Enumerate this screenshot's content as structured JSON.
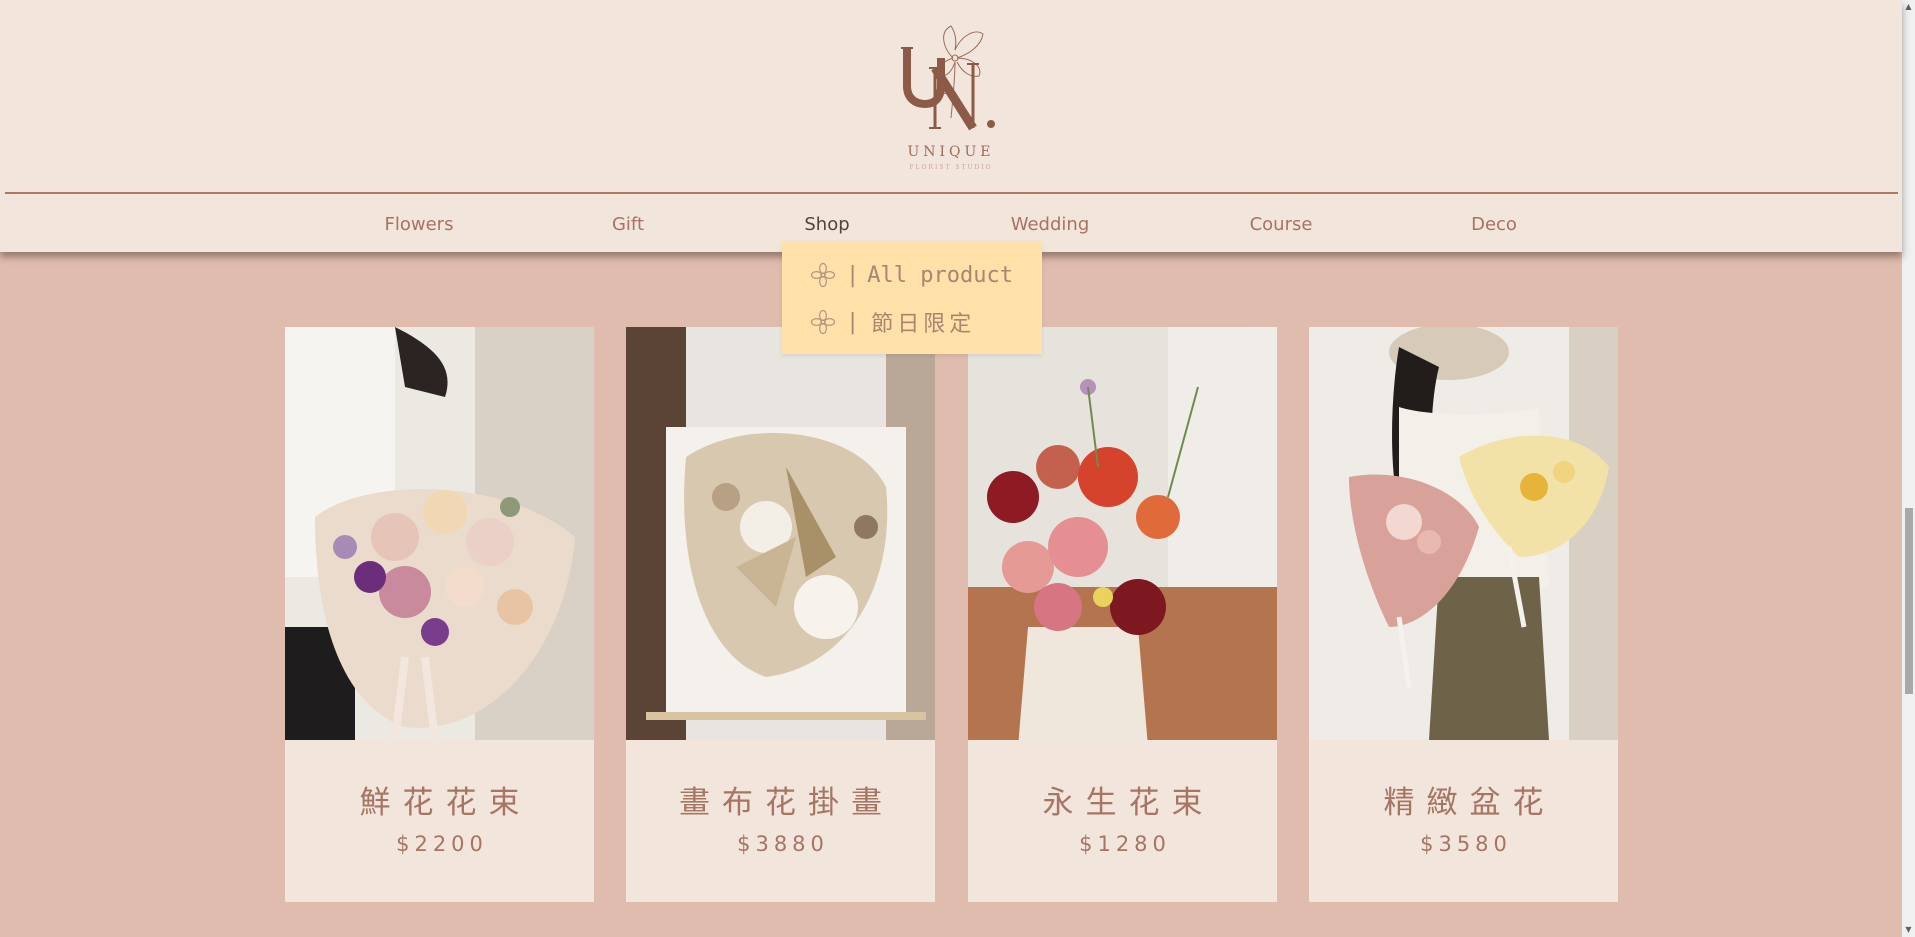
{
  "brand": {
    "monogram": "UN.",
    "title": "UNIQUE",
    "subtitle": "FLORIST STUDIO"
  },
  "nav": {
    "items": [
      {
        "label": "Flowers"
      },
      {
        "label": "Gift"
      },
      {
        "label": "Shop"
      },
      {
        "label": "Wedding"
      },
      {
        "label": "Course"
      },
      {
        "label": "Deco"
      }
    ],
    "active": "Shop"
  },
  "shop_menu": {
    "items": [
      {
        "icon": "flower-outline-icon",
        "separator": "|",
        "label": "All product"
      },
      {
        "icon": "flower-outline-icon",
        "separator": "|",
        "label": "節日限定"
      }
    ]
  },
  "products": [
    {
      "name": "鮮花花束",
      "price": "$2200",
      "image": "fresh-bouquet-photo"
    },
    {
      "name": "畫布花掛畫",
      "price": "$3880",
      "image": "canvas-floral-art-photo"
    },
    {
      "name": "永生花束",
      "price": "$1280",
      "image": "preserved-bouquet-photo"
    },
    {
      "name": "精緻盆花",
      "price": "$3580",
      "image": "potted-arrangement-photo"
    }
  ],
  "colors": {
    "page_bg": "#dfbcad",
    "header_bg": "#f1e5dc",
    "accent": "#a87362",
    "active_nav": "#55423b",
    "dropdown_bg": "#ffe1a9"
  }
}
